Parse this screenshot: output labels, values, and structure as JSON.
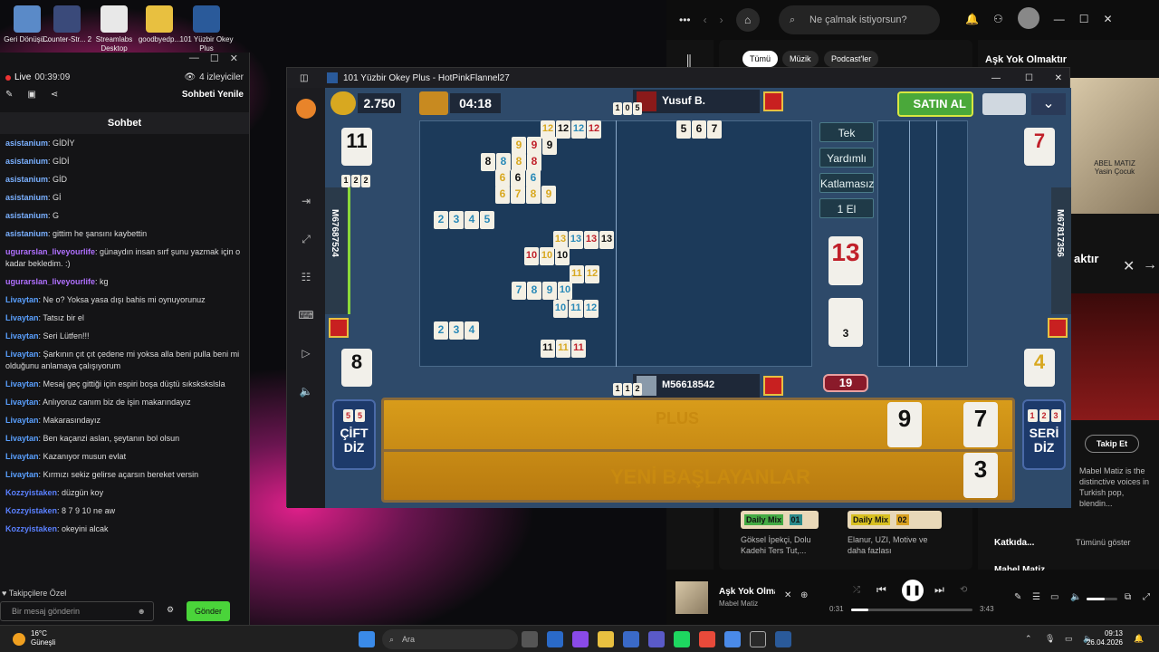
{
  "desktop": {
    "icons": [
      {
        "label": "Geri Dönüşü...",
        "color": "#5a8ac8"
      },
      {
        "label": "Counter-Str... 2",
        "color": "#3a4a7a"
      },
      {
        "label": "Streamlabs Desktop",
        "color": "#e8e8e8"
      },
      {
        "label": "goodbyedp...",
        "color": "#e8c040"
      },
      {
        "label": "101 Yüzbir Okey Plus",
        "color": "#2a5a9a"
      }
    ]
  },
  "chat": {
    "live": "Live",
    "time": "00:39:09",
    "viewers": "4 izleyiciler",
    "reset": "Sohbeti Yenile",
    "title": "Sohbet",
    "messages": [
      {
        "user": "asistanium",
        "text": "GİDİY",
        "color": "#7ab0ff"
      },
      {
        "user": "asistanium",
        "text": "GİDİ",
        "color": "#7ab0ff"
      },
      {
        "user": "asistanium",
        "text": "GİD",
        "color": "#7ab0ff"
      },
      {
        "user": "asistanium",
        "text": "Gİ",
        "color": "#7ab0ff"
      },
      {
        "user": "asistanium",
        "text": "G",
        "color": "#7ab0ff"
      },
      {
        "user": "asistanium",
        "text": "gittim he şansını kaybettin",
        "color": "#7ab0ff"
      },
      {
        "user": "ugurarslan_liveyourlife",
        "text": "günaydın insan sırf şunu yazmak için o kadar bekledim. :)",
        "color": "#b070ff"
      },
      {
        "user": "ugurarslan_liveyourlife",
        "text": "kg",
        "color": "#b070ff"
      },
      {
        "user": "Livaytan",
        "text": "Ne o? Yoksa yasa dışı bahis mi oynuyorunuz",
        "color": "#5aa0ff"
      },
      {
        "user": "Livaytan",
        "text": "Tatsız bir el",
        "color": "#5aa0ff"
      },
      {
        "user": "Livaytan",
        "text": "Seri Lütfen!!!",
        "color": "#5aa0ff"
      },
      {
        "user": "Livaytan",
        "text": "Şarkının çıt çıt çedene mi yoksa alla beni pulla beni mi olduğunu anlamaya çalışıyorum",
        "color": "#5aa0ff"
      },
      {
        "user": "Livaytan",
        "text": "Mesaj geç gittiği için espiri boşa düştü sıkskskslsla",
        "color": "#5aa0ff"
      },
      {
        "user": "Livaytan",
        "text": "Anlıyoruz canım biz de işin makarındayız",
        "color": "#5aa0ff"
      },
      {
        "user": "Livaytan",
        "text": "Makarasındayız",
        "color": "#5aa0ff"
      },
      {
        "user": "Livaytan",
        "text": "Ben kaçanzi aslan, şeytanın bol olsun",
        "color": "#5aa0ff"
      },
      {
        "user": "Livaytan",
        "text": "Kazanıyor musun evlat",
        "color": "#5aa0ff"
      },
      {
        "user": "Livaytan",
        "text": "Kırmızı sekiz gelirse açarsın bereket versin",
        "color": "#5aa0ff"
      },
      {
        "user": "Kozzyistaken",
        "text": "düzgün koy",
        "color": "#5a80ff"
      },
      {
        "user": "Kozzyistaken",
        "text": "8 7 9 10 ne aw",
        "color": "#5a80ff"
      },
      {
        "user": "Kozzyistaken",
        "text": "okeyini alcak",
        "color": "#5a80ff"
      }
    ],
    "followers_only": "Takipçilere Özel",
    "input_placeholder": "Bir mesaj gönderin",
    "send": "Gönder"
  },
  "game": {
    "window_title": "101 Yüzbir Okey Plus - HotPinkFlannel27",
    "coins": "2.750",
    "timer": "04:18",
    "buy": "SATIN AL",
    "players": {
      "top": "Yusuf B.",
      "left": "M67687524",
      "right": "M67817356",
      "bottom": "M56618542"
    },
    "options": [
      "Tek",
      "Yardımlı",
      "Katlamasız",
      "1 El"
    ],
    "left_top_count": "11",
    "left_bottom_count": "8",
    "right_top_count": "7",
    "right_bottom_count": "4",
    "indicator": "13",
    "deck_count": "3",
    "score_badge": "19",
    "left_button": "ÇİFT DİZ",
    "right_button": "SERİ DİZ",
    "rack_text": "YENİ BAŞLAYANLAR",
    "rack_logo": "PLUS",
    "rack_tiles": [
      {
        "n": "9",
        "c": "red"
      },
      {
        "n": "7",
        "c": "red"
      },
      {
        "n": "3",
        "c": "blk"
      }
    ],
    "left_btn_tiles": [
      "5",
      "5"
    ],
    "right_btn_tiles": [
      "1",
      "2",
      "3"
    ],
    "badge_tiles": [
      "1",
      "2"
    ],
    "top_badge_tiles": [
      "1",
      "0",
      "5"
    ],
    "bottom_badge_tiles": [
      "1",
      "1",
      "2"
    ],
    "top_tiles": [
      {
        "n": "5",
        "c": "blk"
      },
      {
        "n": "6",
        "c": "blk"
      },
      {
        "n": "7",
        "c": "blk"
      }
    ],
    "board_rows": [
      [
        {
          "n": "12",
          "c": "yel"
        },
        {
          "n": "12",
          "c": "blk"
        },
        {
          "n": "12",
          "c": "blu"
        },
        {
          "n": "12",
          "c": "red"
        }
      ],
      [
        {
          "n": "9",
          "c": "yel"
        },
        {
          "n": "9",
          "c": "red"
        },
        {
          "n": "9",
          "c": "blk"
        }
      ],
      [
        {
          "n": "8",
          "c": "blk"
        },
        {
          "n": "8",
          "c": "blu"
        },
        {
          "n": "8",
          "c": "yel"
        },
        {
          "n": "8",
          "c": "red"
        }
      ],
      [
        {
          "n": "6",
          "c": "yel"
        },
        {
          "n": "6",
          "c": "blk"
        },
        {
          "n": "6",
          "c": "blu"
        }
      ],
      [
        {
          "n": "6",
          "c": "yel"
        },
        {
          "n": "7",
          "c": "yel"
        },
        {
          "n": "8",
          "c": "yel"
        },
        {
          "n": "9",
          "c": "yel"
        }
      ],
      [
        {
          "n": "2",
          "c": "blu"
        },
        {
          "n": "3",
          "c": "blu"
        },
        {
          "n": "4",
          "c": "blu"
        },
        {
          "n": "5",
          "c": "blu"
        }
      ],
      [
        {
          "n": "13",
          "c": "yel"
        },
        {
          "n": "13",
          "c": "blu"
        },
        {
          "n": "13",
          "c": "red"
        },
        {
          "n": "13",
          "c": "blk"
        }
      ],
      [
        {
          "n": "10",
          "c": "red"
        },
        {
          "n": "10",
          "c": "yel"
        },
        {
          "n": "10",
          "c": "blk"
        }
      ],
      [
        {
          "n": "11",
          "c": "yel"
        },
        {
          "n": "12",
          "c": "yel"
        }
      ],
      [
        {
          "n": "7",
          "c": "blu"
        },
        {
          "n": "8",
          "c": "blu"
        },
        {
          "n": "9",
          "c": "blu"
        },
        {
          "n": "10",
          "c": "blu"
        }
      ],
      [
        {
          "n": "10",
          "c": "blu"
        },
        {
          "n": "11",
          "c": "blu"
        },
        {
          "n": "12",
          "c": "blu"
        }
      ],
      [
        {
          "n": "2",
          "c": "blu"
        },
        {
          "n": "3",
          "c": "blu"
        },
        {
          "n": "4",
          "c": "blu"
        }
      ],
      [
        {
          "n": "11",
          "c": "blk"
        },
        {
          "n": "11",
          "c": "yel"
        },
        {
          "n": "11",
          "c": "red"
        }
      ]
    ]
  },
  "spotify": {
    "search_placeholder": "Ne çalmak istiyorsun?",
    "tabs": [
      "Tümü",
      "Müzik",
      "Podcast'ler"
    ],
    "now_playing_title": "Aşk Yok Olmaktır",
    "artist_panel_text": "aktır",
    "artist_name": "ABEL MATIZ",
    "artist_sub": "Yasin Çocuk",
    "follow": "Takip Et",
    "bio": "Mabel Matiz is the distinctive voices in Turkish pop, blendin...",
    "daily_mix_1": "Daily Mix",
    "daily_mix_1_num": "01",
    "daily_mix_2": "Daily Mix",
    "daily_mix_2_num": "02",
    "mix_1_desc": "Göksel İpekçi, Dolu Kadehi Ters Tut,...",
    "mix_2_desc": "Elanur, UZI, Motive ve daha fazlası",
    "contributors": "Katkıda...",
    "show_all": "Tümünü göster",
    "contributor_name": "Mabel Matiz",
    "track_title": "Aşk Yok Olmak",
    "track_artist": "Mabel Matiz",
    "time_current": "0:31",
    "time_total": "3:43",
    "progress": 0.14,
    "volume": 0.6
  },
  "taskbar": {
    "temp": "16°C",
    "weather": "Güneşli",
    "search": "Ara",
    "time": "09:13",
    "date": "26.04.2026"
  }
}
